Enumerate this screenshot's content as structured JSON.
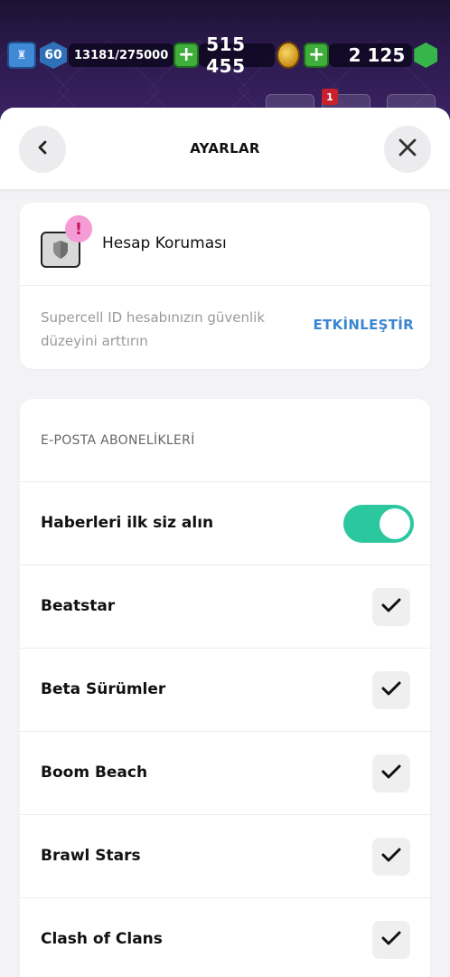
{
  "game_bar": {
    "level": "60",
    "xp": "13181/275000",
    "gold": "515 455",
    "gems": "2 125",
    "notification_count": "1"
  },
  "header": {
    "title": "AYARLAR",
    "back_icon": "chevron-left-icon",
    "close_icon": "close-icon"
  },
  "protection": {
    "title": "Hesap Koruması",
    "badge": "!",
    "description": "Supercell ID hesabınızın güvenlik düzeyini arttırın",
    "action": "ETKİNLEŞTİR"
  },
  "subscriptions": {
    "section_title": "E-POSTA ABONELİKLERİ",
    "news_label": "Haberleri ilk siz alın",
    "news_enabled": true,
    "items": [
      {
        "label": "Beatstar",
        "checked": true
      },
      {
        "label": "Beta Sürümler",
        "checked": true
      },
      {
        "label": "Boom Beach",
        "checked": true
      },
      {
        "label": "Brawl Stars",
        "checked": true
      },
      {
        "label": "Clash of Clans",
        "checked": true
      }
    ]
  },
  "colors": {
    "accent_link": "#3a86d1",
    "toggle_on": "#2bc8a0",
    "badge_pink": "#f59bd6"
  }
}
